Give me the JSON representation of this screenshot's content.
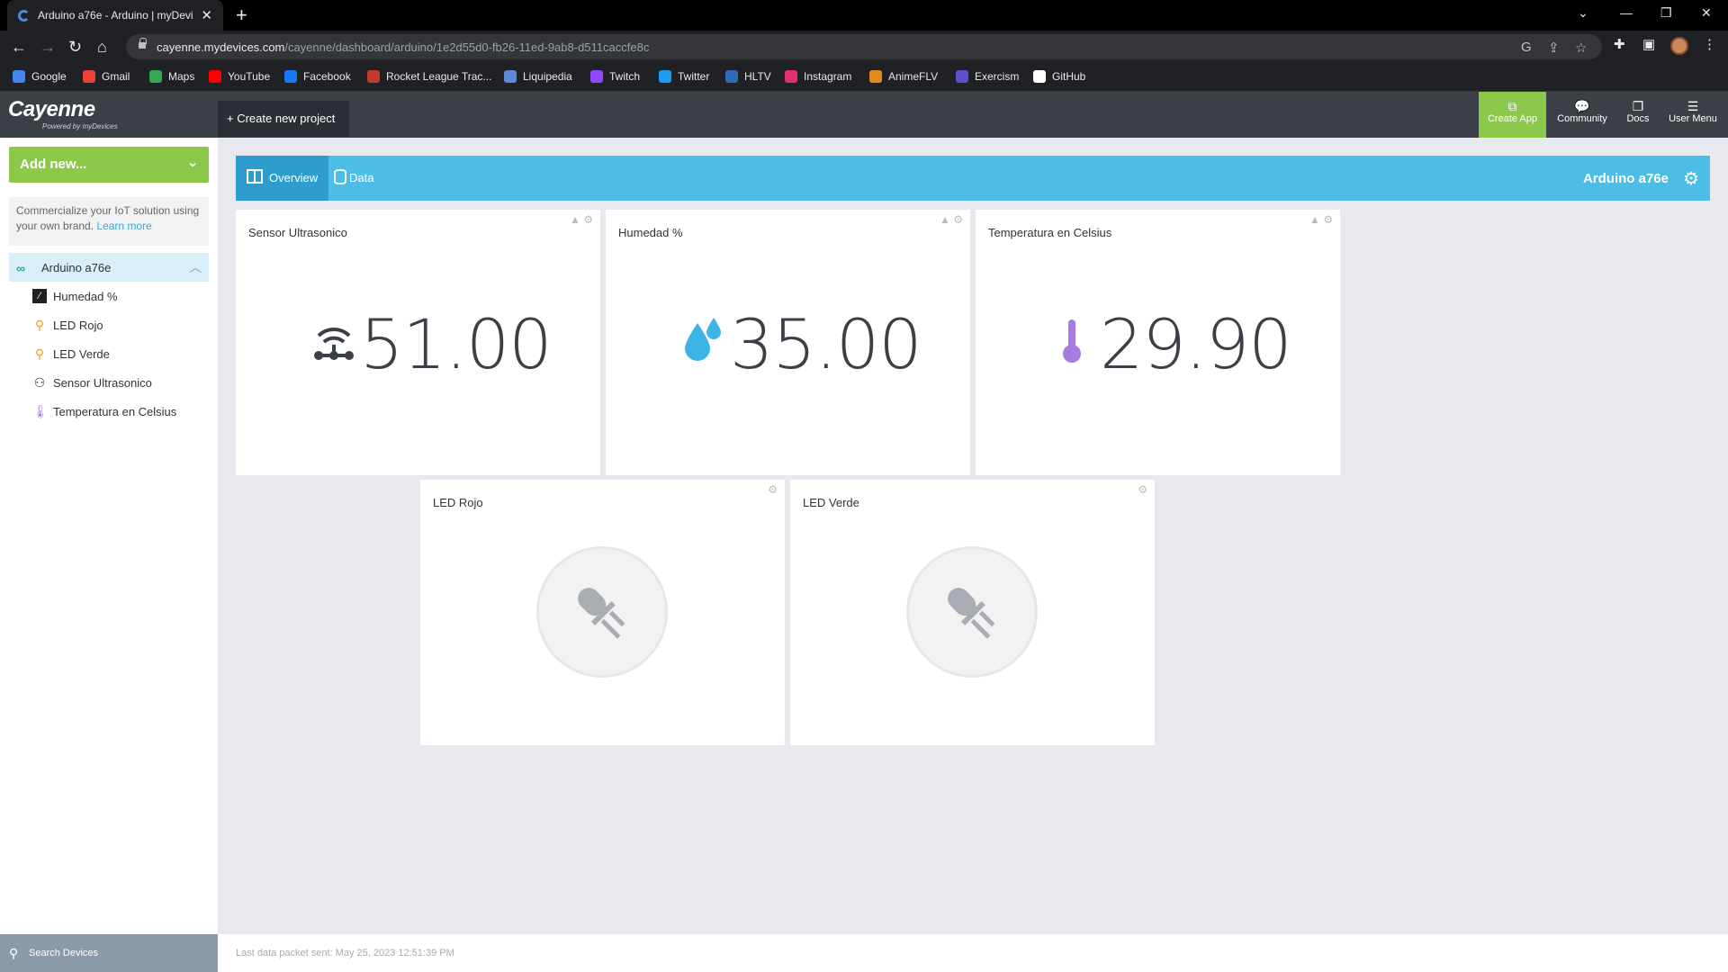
{
  "browser": {
    "tab_title": "Arduino a76e - Arduino | myDevi",
    "url_domain": "cayenne.mydevices.com",
    "url_path": "/cayenne/dashboard/arduino/1e2d55d0-fb26-11ed-9ab8-d511caccfe8c",
    "bookmarks": [
      {
        "label": "Google",
        "color": "#4285f4"
      },
      {
        "label": "Gmail",
        "color": "#ea4335"
      },
      {
        "label": "Maps",
        "color": "#34a853"
      },
      {
        "label": "YouTube",
        "color": "#ff0000"
      },
      {
        "label": "Facebook",
        "color": "#1877f2"
      },
      {
        "label": "Rocket League Trac...",
        "color": "#c0392b"
      },
      {
        "label": "Liquipedia",
        "color": "#5b8bd6"
      },
      {
        "label": "Twitch",
        "color": "#9146ff"
      },
      {
        "label": "Twitter",
        "color": "#1d9bf0"
      },
      {
        "label": "HLTV",
        "color": "#2d6bb6"
      },
      {
        "label": "Instagram",
        "color": "#e1306c"
      },
      {
        "label": "AnimeFLV",
        "color": "#e38a1c"
      },
      {
        "label": "Exercism",
        "color": "#604fcd"
      },
      {
        "label": "GitHub",
        "color": "#ffffff"
      }
    ]
  },
  "header": {
    "logo": "Cayenne",
    "logo_sub": "Powered by myDevices",
    "create_project": "Create new project",
    "create_app": "Create App",
    "community": "Community",
    "docs": "Docs",
    "user_menu": "User Menu",
    "accent": "#8cc94a"
  },
  "sidebar": {
    "add_new": "Add new...",
    "promo_text": "Commercialize your IoT solution using your own brand.",
    "promo_link": "Learn more",
    "device": "Arduino a76e",
    "items": [
      {
        "label": "Humedad %",
        "icon": "humidity-chart-icon"
      },
      {
        "label": "LED Rojo",
        "icon": "led-icon"
      },
      {
        "label": "LED Verde",
        "icon": "led-icon"
      },
      {
        "label": "Sensor Ultrasonico",
        "icon": "ultrasonic-icon"
      },
      {
        "label": "Temperatura en Celsius",
        "icon": "thermometer-icon"
      }
    ],
    "search_placeholder": "Search Devices"
  },
  "main": {
    "tab_overview": "Overview",
    "tab_data": "Data",
    "device_name": "Arduino a76e",
    "widgets": [
      {
        "title": "Sensor Ultrasonico",
        "value": "51.00",
        "icon": "ultrasonic-icon"
      },
      {
        "title": "Humedad %",
        "value": "35.00",
        "icon": "water-drops-icon"
      },
      {
        "title": "Temperatura en Celsius",
        "value": "29.90",
        "icon": "thermometer-icon"
      }
    ],
    "led_widgets": [
      {
        "title": "LED Rojo"
      },
      {
        "title": "LED Verde"
      }
    ],
    "footer": "Last data packet sent: May 25, 2023 12:51:39 PM"
  }
}
